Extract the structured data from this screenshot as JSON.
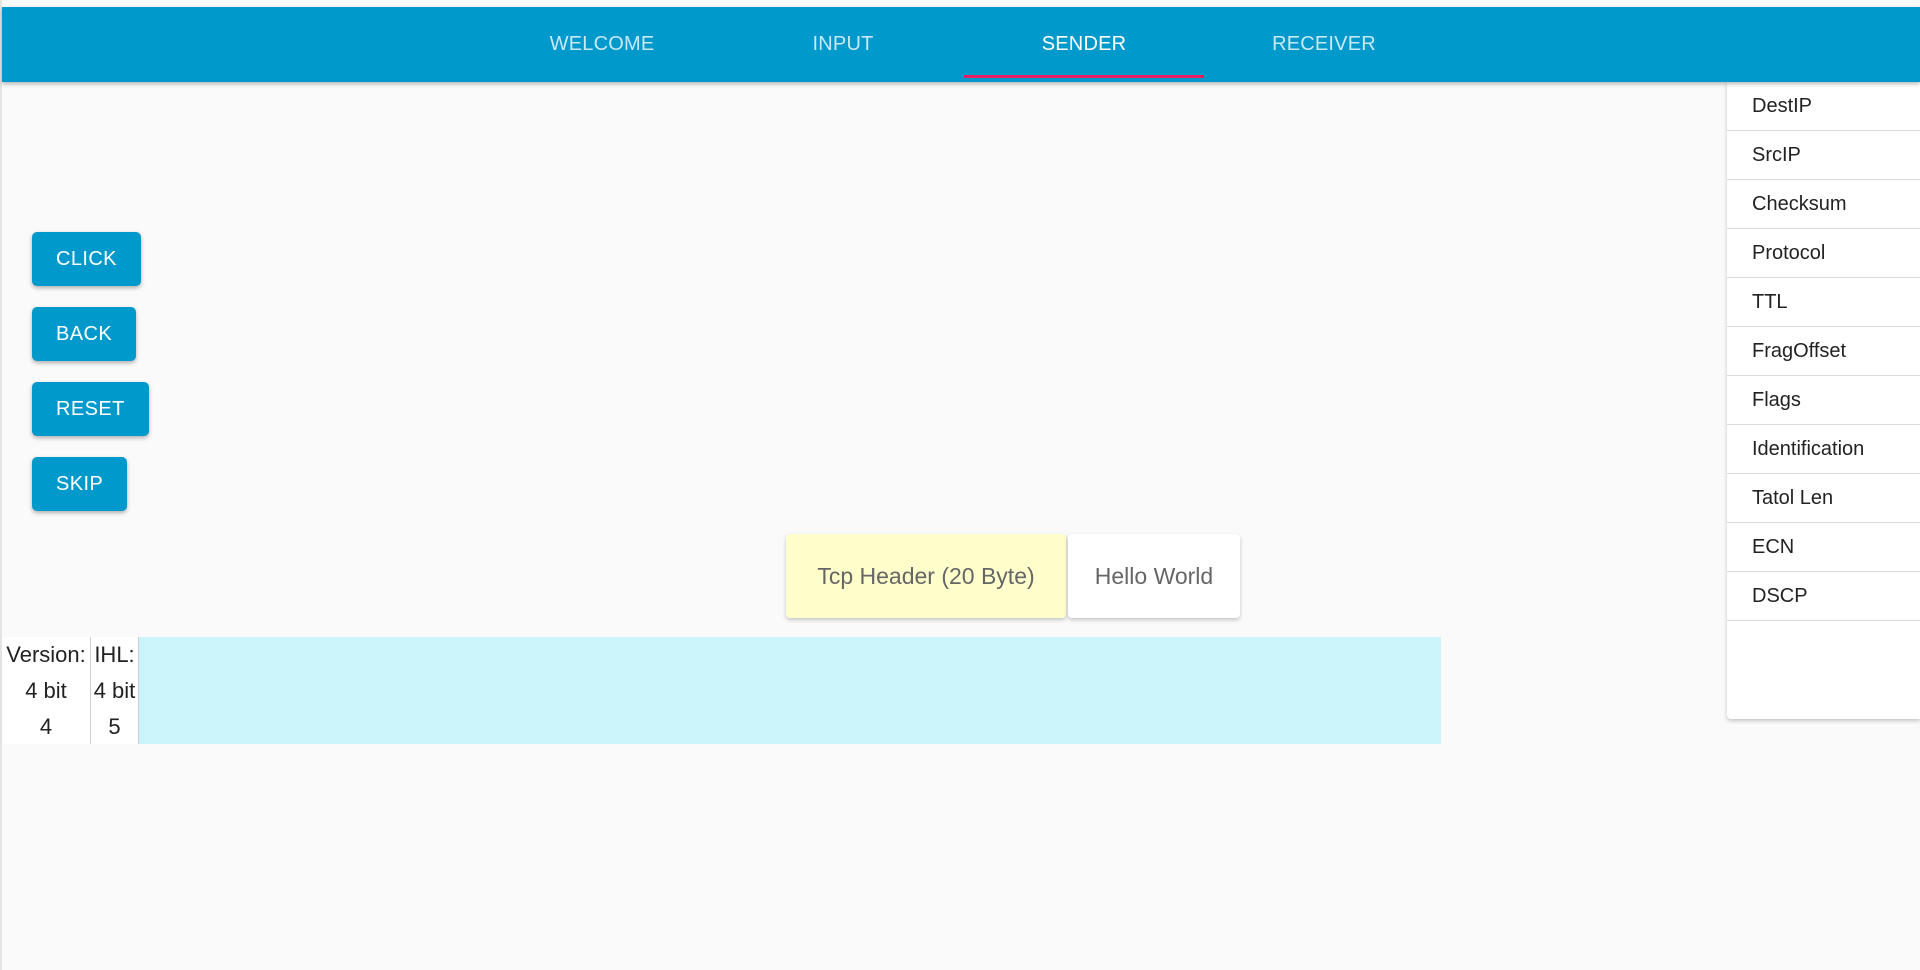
{
  "tabs": [
    {
      "label": "WELCOME"
    },
    {
      "label": "INPUT"
    },
    {
      "label": "SENDER"
    },
    {
      "label": "RECEIVER"
    }
  ],
  "active_tab": "SENDER",
  "buttons": {
    "click": "CLICK",
    "back": "BACK",
    "reset": "RESET",
    "skip": "SKIP"
  },
  "packet": {
    "header_label": "Tcp Header (20 Byte)",
    "payload_label": "Hello World"
  },
  "fields": [
    {
      "name": "Version:",
      "size": "4 bit",
      "value": "4"
    },
    {
      "name": "IHL:",
      "size": "4 bit",
      "value": "5"
    }
  ],
  "side_fields": [
    "DestIP",
    "SrcIP",
    "Checksum",
    "Protocol",
    "TTL",
    "FragOffset",
    "Flags",
    "Identification",
    "Tatol Len",
    "ECN",
    "DSCP"
  ],
  "colors": {
    "primary": "#0099cc",
    "tab_indicator": "#e91e63",
    "header_chip": "#ffffcc",
    "field_strip": "#ccf5fb"
  }
}
